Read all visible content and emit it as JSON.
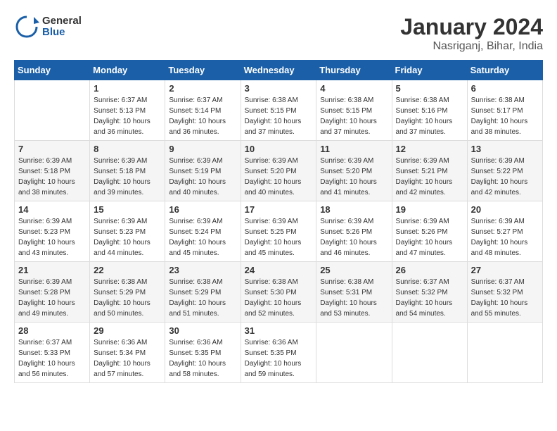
{
  "header": {
    "logo_general": "General",
    "logo_blue": "Blue",
    "title": "January 2024",
    "subtitle": "Nasriganj, Bihar, India"
  },
  "weekdays": [
    "Sunday",
    "Monday",
    "Tuesday",
    "Wednesday",
    "Thursday",
    "Friday",
    "Saturday"
  ],
  "weeks": [
    [
      {
        "day": "",
        "info": ""
      },
      {
        "day": "1",
        "info": "Sunrise: 6:37 AM\nSunset: 5:13 PM\nDaylight: 10 hours\nand 36 minutes."
      },
      {
        "day": "2",
        "info": "Sunrise: 6:37 AM\nSunset: 5:14 PM\nDaylight: 10 hours\nand 36 minutes."
      },
      {
        "day": "3",
        "info": "Sunrise: 6:38 AM\nSunset: 5:15 PM\nDaylight: 10 hours\nand 37 minutes."
      },
      {
        "day": "4",
        "info": "Sunrise: 6:38 AM\nSunset: 5:15 PM\nDaylight: 10 hours\nand 37 minutes."
      },
      {
        "day": "5",
        "info": "Sunrise: 6:38 AM\nSunset: 5:16 PM\nDaylight: 10 hours\nand 37 minutes."
      },
      {
        "day": "6",
        "info": "Sunrise: 6:38 AM\nSunset: 5:17 PM\nDaylight: 10 hours\nand 38 minutes."
      }
    ],
    [
      {
        "day": "7",
        "info": "Sunrise: 6:39 AM\nSunset: 5:18 PM\nDaylight: 10 hours\nand 38 minutes."
      },
      {
        "day": "8",
        "info": "Sunrise: 6:39 AM\nSunset: 5:18 PM\nDaylight: 10 hours\nand 39 minutes."
      },
      {
        "day": "9",
        "info": "Sunrise: 6:39 AM\nSunset: 5:19 PM\nDaylight: 10 hours\nand 40 minutes."
      },
      {
        "day": "10",
        "info": "Sunrise: 6:39 AM\nSunset: 5:20 PM\nDaylight: 10 hours\nand 40 minutes."
      },
      {
        "day": "11",
        "info": "Sunrise: 6:39 AM\nSunset: 5:20 PM\nDaylight: 10 hours\nand 41 minutes."
      },
      {
        "day": "12",
        "info": "Sunrise: 6:39 AM\nSunset: 5:21 PM\nDaylight: 10 hours\nand 42 minutes."
      },
      {
        "day": "13",
        "info": "Sunrise: 6:39 AM\nSunset: 5:22 PM\nDaylight: 10 hours\nand 42 minutes."
      }
    ],
    [
      {
        "day": "14",
        "info": "Sunrise: 6:39 AM\nSunset: 5:23 PM\nDaylight: 10 hours\nand 43 minutes."
      },
      {
        "day": "15",
        "info": "Sunrise: 6:39 AM\nSunset: 5:23 PM\nDaylight: 10 hours\nand 44 minutes."
      },
      {
        "day": "16",
        "info": "Sunrise: 6:39 AM\nSunset: 5:24 PM\nDaylight: 10 hours\nand 45 minutes."
      },
      {
        "day": "17",
        "info": "Sunrise: 6:39 AM\nSunset: 5:25 PM\nDaylight: 10 hours\nand 45 minutes."
      },
      {
        "day": "18",
        "info": "Sunrise: 6:39 AM\nSunset: 5:26 PM\nDaylight: 10 hours\nand 46 minutes."
      },
      {
        "day": "19",
        "info": "Sunrise: 6:39 AM\nSunset: 5:26 PM\nDaylight: 10 hours\nand 47 minutes."
      },
      {
        "day": "20",
        "info": "Sunrise: 6:39 AM\nSunset: 5:27 PM\nDaylight: 10 hours\nand 48 minutes."
      }
    ],
    [
      {
        "day": "21",
        "info": "Sunrise: 6:39 AM\nSunset: 5:28 PM\nDaylight: 10 hours\nand 49 minutes."
      },
      {
        "day": "22",
        "info": "Sunrise: 6:38 AM\nSunset: 5:29 PM\nDaylight: 10 hours\nand 50 minutes."
      },
      {
        "day": "23",
        "info": "Sunrise: 6:38 AM\nSunset: 5:29 PM\nDaylight: 10 hours\nand 51 minutes."
      },
      {
        "day": "24",
        "info": "Sunrise: 6:38 AM\nSunset: 5:30 PM\nDaylight: 10 hours\nand 52 minutes."
      },
      {
        "day": "25",
        "info": "Sunrise: 6:38 AM\nSunset: 5:31 PM\nDaylight: 10 hours\nand 53 minutes."
      },
      {
        "day": "26",
        "info": "Sunrise: 6:37 AM\nSunset: 5:32 PM\nDaylight: 10 hours\nand 54 minutes."
      },
      {
        "day": "27",
        "info": "Sunrise: 6:37 AM\nSunset: 5:32 PM\nDaylight: 10 hours\nand 55 minutes."
      }
    ],
    [
      {
        "day": "28",
        "info": "Sunrise: 6:37 AM\nSunset: 5:33 PM\nDaylight: 10 hours\nand 56 minutes."
      },
      {
        "day": "29",
        "info": "Sunrise: 6:36 AM\nSunset: 5:34 PM\nDaylight: 10 hours\nand 57 minutes."
      },
      {
        "day": "30",
        "info": "Sunrise: 6:36 AM\nSunset: 5:35 PM\nDaylight: 10 hours\nand 58 minutes."
      },
      {
        "day": "31",
        "info": "Sunrise: 6:36 AM\nSunset: 5:35 PM\nDaylight: 10 hours\nand 59 minutes."
      },
      {
        "day": "",
        "info": ""
      },
      {
        "day": "",
        "info": ""
      },
      {
        "day": "",
        "info": ""
      }
    ]
  ]
}
